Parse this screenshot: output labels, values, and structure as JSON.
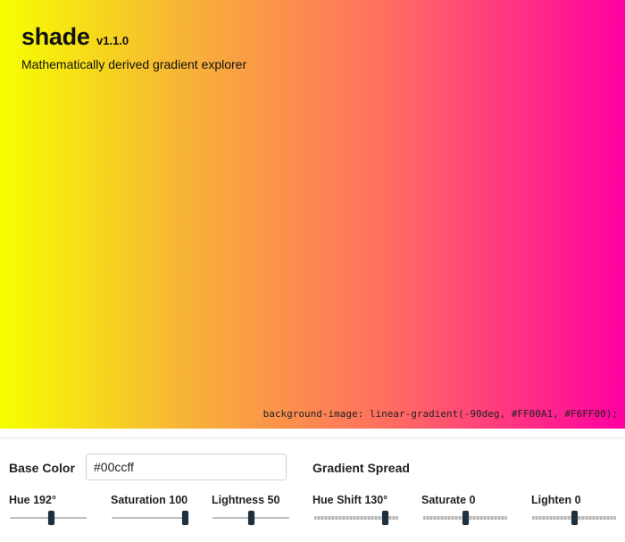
{
  "header": {
    "app_name": "shade",
    "version": "v1.1.0",
    "tagline": "Mathematically derived gradient explorer"
  },
  "preview": {
    "css_code": "background-image: linear-gradient(-90deg, #FF00A1, #F6FF00);",
    "gradient_start": "#F6FF00",
    "gradient_end": "#FF00A1"
  },
  "controls": {
    "base_color_label": "Base Color",
    "base_color_value": "#00ccff",
    "gradient_spread_label": "Gradient Spread",
    "sliders": [
      {
        "label": "Hue 192°",
        "fraction": 0.53
      },
      {
        "label": "Saturation 100",
        "fraction": 0.95
      },
      {
        "label": "Lightness 50",
        "fraction": 0.5
      },
      {
        "label": "Hue Shift 130°",
        "fraction": 0.84
      },
      {
        "label": "Saturate 0",
        "fraction": 0.5
      },
      {
        "label": "Lighten 0",
        "fraction": 0.5
      }
    ]
  }
}
